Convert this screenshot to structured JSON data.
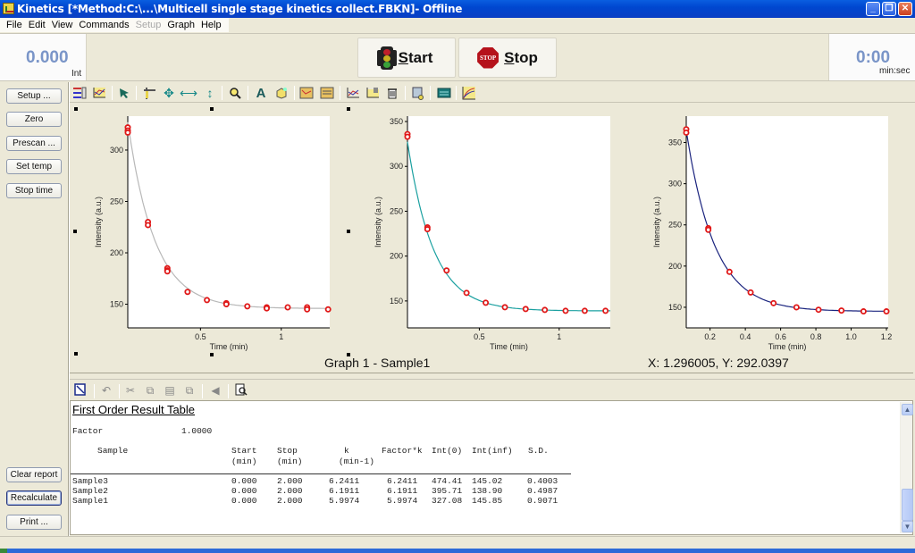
{
  "window": {
    "title": "Kinetics [*Method:C:\\...\\Multicell single stage kinetics collect.FBKN]- Offline",
    "controls": [
      "minimize",
      "restore",
      "close"
    ]
  },
  "menu": {
    "items": [
      {
        "label": "File",
        "enabled": true
      },
      {
        "label": "Edit",
        "enabled": true
      },
      {
        "label": "View",
        "enabled": true
      },
      {
        "label": "Commands",
        "enabled": true
      },
      {
        "label": "Setup",
        "enabled": false
      },
      {
        "label": "Graph",
        "enabled": true
      },
      {
        "label": "Help",
        "enabled": true
      }
    ]
  },
  "top_panel": {
    "intensity_value": "0.000",
    "intensity_unit": "Int",
    "start_label": "Start",
    "start_accel": "S",
    "stop_label": "Stop",
    "stop_accel": "S",
    "stop_sign_text": "STOP",
    "time_value": "0:00",
    "time_unit": "min:sec"
  },
  "sidebar": {
    "top_buttons": [
      {
        "label": "Setup ..."
      },
      {
        "label": "Zero"
      },
      {
        "label": "Prescan ..."
      },
      {
        "label": "Set temp"
      },
      {
        "label": "Stop time"
      }
    ],
    "bottom_buttons": [
      {
        "label": "Clear report"
      },
      {
        "label": "Recalculate",
        "focused": true
      },
      {
        "label": "Print ..."
      }
    ]
  },
  "graph_toolbar": {
    "icons": [
      "graph-legend-icon",
      "graph-format-icon",
      "pointer-icon",
      "cursor-crosshair-icon",
      "pan-icon",
      "pan-horizontal-icon",
      "pan-vertical-icon",
      "zoom-icon",
      "text-icon",
      "annotate-icon",
      "overlay-icon",
      "overlay-settings-icon",
      "scale-icon",
      "delete-trace-icon",
      "trash-icon",
      "print-graph-icon",
      "calculator-icon",
      "fit-curve-icon"
    ]
  },
  "graph": {
    "caption": "Graph 1 - Sample1",
    "cursor_readout": "X: 1.296005, Y: 292.0397"
  },
  "chart_data": [
    {
      "type": "scatter",
      "title": "",
      "xlabel": "Time (min)",
      "ylabel": "Intensity (a.u.)",
      "xlim": [
        0.05,
        1.3
      ],
      "ylim": [
        127,
        333
      ],
      "x_ticks": [
        0.5,
        1
      ],
      "x_tick_labels": [
        "0.5",
        "1"
      ],
      "y_ticks": [
        150,
        200,
        250,
        300
      ],
      "y_tick_labels": [
        "150",
        "200",
        "250",
        "300"
      ],
      "fit_color": "#b8b8b8",
      "point_color": "#e01818",
      "fit": {
        "y0": 327.08,
        "yinf": 145.85,
        "k": 5.9974,
        "t0": 0.05
      },
      "points": {
        "x": [
          0.05,
          0.05,
          0.05,
          0.175,
          0.175,
          0.295,
          0.295,
          0.295,
          0.42,
          0.54,
          0.66,
          0.66,
          0.79,
          0.91,
          0.91,
          1.04,
          1.16,
          1.16,
          1.29
        ],
        "y": [
          322,
          319,
          317,
          230,
          227,
          185,
          183,
          182,
          162,
          154,
          151,
          150,
          148,
          147,
          146,
          147,
          147,
          145,
          145
        ]
      }
    },
    {
      "type": "scatter",
      "title": "",
      "xlabel": "Time (min)",
      "ylabel": "Intensity (a.u.)",
      "xlim": [
        0.05,
        1.32
      ],
      "ylim": [
        120,
        356
      ],
      "x_ticks": [
        0.5,
        1
      ],
      "x_tick_labels": [
        "0.5",
        "1"
      ],
      "y_ticks": [
        150,
        200,
        250,
        300,
        350
      ],
      "y_tick_labels": [
        "150",
        "200",
        "250",
        "300",
        "350"
      ],
      "fit_color": "#1aa0a0",
      "point_color": "#e01818",
      "fit": {
        "y0": 395.71,
        "yinf": 138.9,
        "k": 6.1911,
        "t0": 0.0
      },
      "points": {
        "x": [
          0.05,
          0.05,
          0.175,
          0.175,
          0.295,
          0.42,
          0.54,
          0.66,
          0.79,
          0.91,
          1.04,
          1.16,
          1.29
        ],
        "y": [
          336,
          333,
          232,
          230,
          184,
          159,
          148,
          143,
          141,
          140,
          139,
          139,
          139
        ]
      }
    },
    {
      "type": "scatter",
      "title": "",
      "xlabel": "Time (min)",
      "ylabel": "Intensity (a.u.)",
      "xlim": [
        0.065,
        1.21
      ],
      "ylim": [
        125,
        382
      ],
      "x_ticks": [
        0.2,
        0.4,
        0.6,
        0.8,
        1.0,
        1.2
      ],
      "x_tick_labels": [
        "0.2",
        "0.4",
        "0.6",
        "0.8",
        "1.0",
        "1.2"
      ],
      "y_ticks": [
        150,
        200,
        250,
        300,
        350
      ],
      "y_tick_labels": [
        "150",
        "200",
        "250",
        "300",
        "350"
      ],
      "fit_color": "#1a237e",
      "point_color": "#e01818",
      "fit": {
        "y0": 474.41,
        "yinf": 145.02,
        "k": 6.2411,
        "t0": 0.0
      },
      "points": {
        "x": [
          0.065,
          0.065,
          0.19,
          0.19,
          0.31,
          0.43,
          0.56,
          0.69,
          0.815,
          0.945,
          1.07,
          1.2
        ],
        "y": [
          366,
          362,
          246,
          244,
          193,
          168,
          155,
          150,
          147,
          146,
          145,
          145
        ]
      }
    }
  ],
  "report_toolbar": {
    "icons": [
      {
        "name": "edit-report-icon",
        "enabled": true
      },
      {
        "name": "undo-icon",
        "enabled": false
      },
      {
        "name": "cut-icon",
        "enabled": false
      },
      {
        "name": "copy-icon",
        "enabled": false
      },
      {
        "name": "paste-icon",
        "enabled": false
      },
      {
        "name": "paste-special-icon",
        "enabled": false
      },
      {
        "name": "send-icon",
        "enabled": false
      },
      {
        "name": "print-preview-icon",
        "enabled": true
      }
    ]
  },
  "report": {
    "title": "First Order Result Table",
    "factor_label": "Factor",
    "factor_value": "1.0000",
    "columns": [
      {
        "label": "Sample",
        "unit": ""
      },
      {
        "label": "Start",
        "unit": "(min)"
      },
      {
        "label": "Stop",
        "unit": "(min)"
      },
      {
        "label": "k",
        "unit": "(min-1)"
      },
      {
        "label": "Factor*k",
        "unit": ""
      },
      {
        "label": "Int(0)",
        "unit": ""
      },
      {
        "label": "Int(inf)",
        "unit": ""
      },
      {
        "label": "S.D.",
        "unit": ""
      }
    ],
    "rows": [
      [
        "Sample3",
        "0.000",
        "2.000",
        "6.2411",
        "6.2411",
        "474.41",
        "145.02",
        "0.4003"
      ],
      [
        "Sample2",
        "0.000",
        "2.000",
        "6.1911",
        "6.1911",
        "395.71",
        "138.90",
        "0.4987"
      ],
      [
        "Sample1",
        "0.000",
        "2.000",
        "5.9974",
        "5.9974",
        "327.08",
        "145.85",
        "0.9071"
      ]
    ]
  }
}
